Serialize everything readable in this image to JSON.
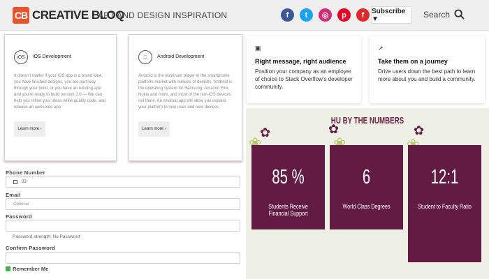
{
  "header": {
    "logo_mark": "CB",
    "logo_text": "CREATIVE BLOQ",
    "tagline": "ART AND DESIGN INSPIRATION",
    "social": [
      {
        "name": "facebook",
        "glyph": "f",
        "color": "#3b5998"
      },
      {
        "name": "twitter",
        "glyph": "t",
        "color": "#1da1f2"
      },
      {
        "name": "instagram",
        "glyph": "◎",
        "color": "#d62976"
      },
      {
        "name": "pinterest",
        "glyph": "p",
        "color": "#e60023"
      },
      {
        "name": "flipboard",
        "glyph": "f",
        "color": "#e12828"
      }
    ],
    "subscribe_label": "Subscribe ▼",
    "search_label": "Search"
  },
  "cards": [
    {
      "icon": "iOS",
      "title": "iOS Development",
      "desc": "It doesn't matter if your iOS app is a brand idea, you have finished designs, you are part-way through your build, or you have an existing app and you're ready to build version 2.0 — We can help you refine your ideas while quality code, and release an awesome app.",
      "button": "Learn more ›"
    },
    {
      "icon": "□",
      "title": "Android Development",
      "desc": "Android is the dominant player in the smartphone platform market with millions of devices, Android is the operating system for Samsung, Amazon Fire, Nokia and more, and most of the non-iOS devices out there. An Android app will allow you expand your platform to new uses and new devices.",
      "button": "Learn more ›"
    }
  ],
  "features": [
    {
      "icon": "▣",
      "title": "Right message, right audience",
      "desc": "Position your company as an employer of choice to Stack Overflow's developer community."
    },
    {
      "icon": "↗",
      "title": "Take them on a journey",
      "desc": "Drive users down the best path to learn more about you and build a community."
    }
  ],
  "stats": {
    "heading": "HU BY THE NUMBERS",
    "items": [
      {
        "value": "85 %",
        "label": "Students Receive Financial Support"
      },
      {
        "value": "6",
        "label": "World Class Degrees"
      },
      {
        "value": "12:1",
        "label": "Student to Faculty Ratio"
      }
    ]
  },
  "form": {
    "phone_label": "Phone Number",
    "phone_value": "03",
    "email_label": "Email",
    "email_placeholder": "Optional",
    "password_label": "Password",
    "password_hint": "Password strength: No Password",
    "confirm_label": "Confirm Password",
    "remember_label": "Remember Me"
  }
}
